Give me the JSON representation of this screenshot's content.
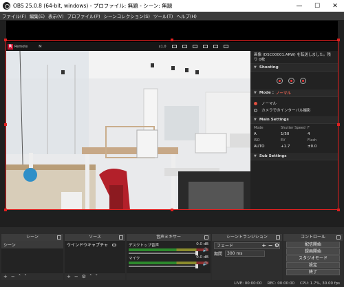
{
  "window": {
    "title": "OBS 25.0.8 (64-bit, windows) - プロファイル: 無題 - シーン: 無題",
    "minimize": "—",
    "maximize": "☐",
    "close": "✕"
  },
  "menu": [
    "ファイル(F)",
    "編集(E)",
    "表示(V)",
    "プロファイル(P)",
    "シーンコレクション(S)",
    "ツール(T)",
    "ヘルプ(H)"
  ],
  "camera": {
    "logo": "R",
    "toolbar_label": "Remote",
    "toolbar_mode": "M",
    "zoom": "x1.0",
    "message": "画像 (DSC00001.ARW) を転送しました。残り 0枚",
    "shooting_title": "Shooting",
    "mode_title": "Mode :",
    "mode_value": "ノーマル",
    "mode_option_1": "ノーマル",
    "mode_option_2": "カメラでのインターバル撮影",
    "main_settings_title": "Main Settings",
    "labels": [
      "Mode",
      "Shutter Speed",
      "F"
    ],
    "values": [
      "A",
      "1/50",
      "4"
    ],
    "labels2": [
      "ISO",
      "EV",
      "Flash"
    ],
    "values2": [
      "AUTO",
      "+1.7",
      "±0.0"
    ],
    "sub_settings_title": "Sub Settings"
  },
  "docks": {
    "scenes": {
      "title": "シーン",
      "items": [
        "シーン"
      ]
    },
    "sources": {
      "title": "ソース",
      "items": [
        "ウインドウキャプチャ"
      ]
    },
    "mixer": {
      "title": "音声ミキサー",
      "channels": [
        {
          "name": "デスクトップ音声",
          "db": "0.0 dB"
        },
        {
          "name": "マイク",
          "db": "0.0 dB"
        }
      ]
    },
    "transitions": {
      "title": "シーントランジション",
      "selected": "フェード",
      "duration_label": "期間",
      "duration_value": "300 ms"
    },
    "controls": {
      "title": "コントロール",
      "buttons": [
        "配信開始",
        "録画開始",
        "スタジオモード",
        "設定",
        "終了"
      ]
    }
  },
  "status": {
    "live": "LIVE: 00:00:00",
    "rec": "REC: 00:00:00",
    "cpu": "CPU: 1.7%, 30.00 fps"
  }
}
